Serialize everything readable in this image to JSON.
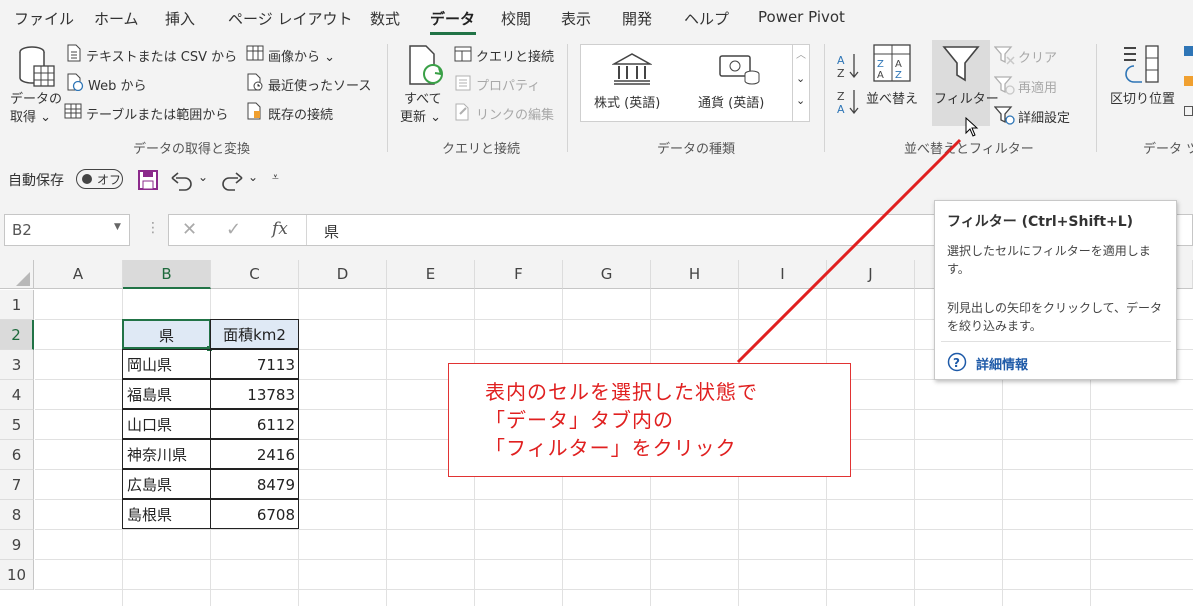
{
  "menu": {
    "tabs": [
      "ファイル",
      "ホーム",
      "挿入",
      "ページ レイアウト",
      "数式",
      "データ",
      "校閲",
      "表示",
      "開発",
      "ヘルプ",
      "Power Pivot"
    ],
    "active_tab": "データ"
  },
  "ribbon": {
    "get_data": {
      "label_line1": "データの",
      "label_line2": "取得 ⌄",
      "text_csv": "テキストまたは CSV から",
      "web": "Web から",
      "table_range": "テーブルまたは範囲から",
      "from_image": "画像から ⌄",
      "recent_sources": "最近使ったソース",
      "existing_connections": "既存の接続",
      "group_label": "データの取得と変換"
    },
    "queries": {
      "refresh_line1": "すべて",
      "refresh_line2": "更新 ⌄",
      "queries_connections": "クエリと接続",
      "properties": "プロパティ",
      "edit_links": "リンクの編集",
      "group_label": "クエリと接続"
    },
    "data_types": {
      "stocks": "株式 (英語)",
      "currencies": "通貨 (英語)",
      "group_label": "データの種類"
    },
    "sort_filter": {
      "sort": "並べ替え",
      "filter": "フィルター",
      "clear": "クリア",
      "reapply": "再適用",
      "advanced": "詳細設定",
      "group_label": "並べ替えとフィルター"
    },
    "data_tools": {
      "text_to_columns": "区切り位置",
      "group_label": "データ ツ"
    }
  },
  "qat": {
    "autosave_label": "自動保存",
    "autosave_state": "オフ"
  },
  "formula_bar": {
    "name_box": "B2",
    "fx": "fx",
    "content": "県"
  },
  "sheet": {
    "columns": [
      "A",
      "B",
      "C",
      "D",
      "E",
      "F",
      "G",
      "H",
      "I",
      "J"
    ],
    "rows": [
      "1",
      "2",
      "3",
      "4",
      "5",
      "6",
      "7",
      "8",
      "9",
      "10"
    ],
    "table": {
      "headers": [
        "県",
        "面積km2"
      ],
      "rows": [
        [
          "岡山県",
          "7113"
        ],
        [
          "福島県",
          "13783"
        ],
        [
          "山口県",
          "6112"
        ],
        [
          "神奈川県",
          "2416"
        ],
        [
          "広島県",
          "8479"
        ],
        [
          "島根県",
          "6708"
        ]
      ]
    }
  },
  "tooltip": {
    "title": "フィルター (Ctrl+Shift+L)",
    "desc1_line1": "選択したセルにフィルターを適用しま",
    "desc1_line2": "す。",
    "desc2_line1": "列見出しの矢印をクリックして、データ",
    "desc2_line2": "を絞り込みます。",
    "link": "詳細情報"
  },
  "callout": {
    "line1": "表内のセルを選択した状態で",
    "line2": "「データ」タブ内の",
    "line3": "「フィルター」をクリック"
  },
  "colors": {
    "accent_green": "#217346",
    "callout_red": "#e02020",
    "link_blue": "#1e5aa8"
  }
}
